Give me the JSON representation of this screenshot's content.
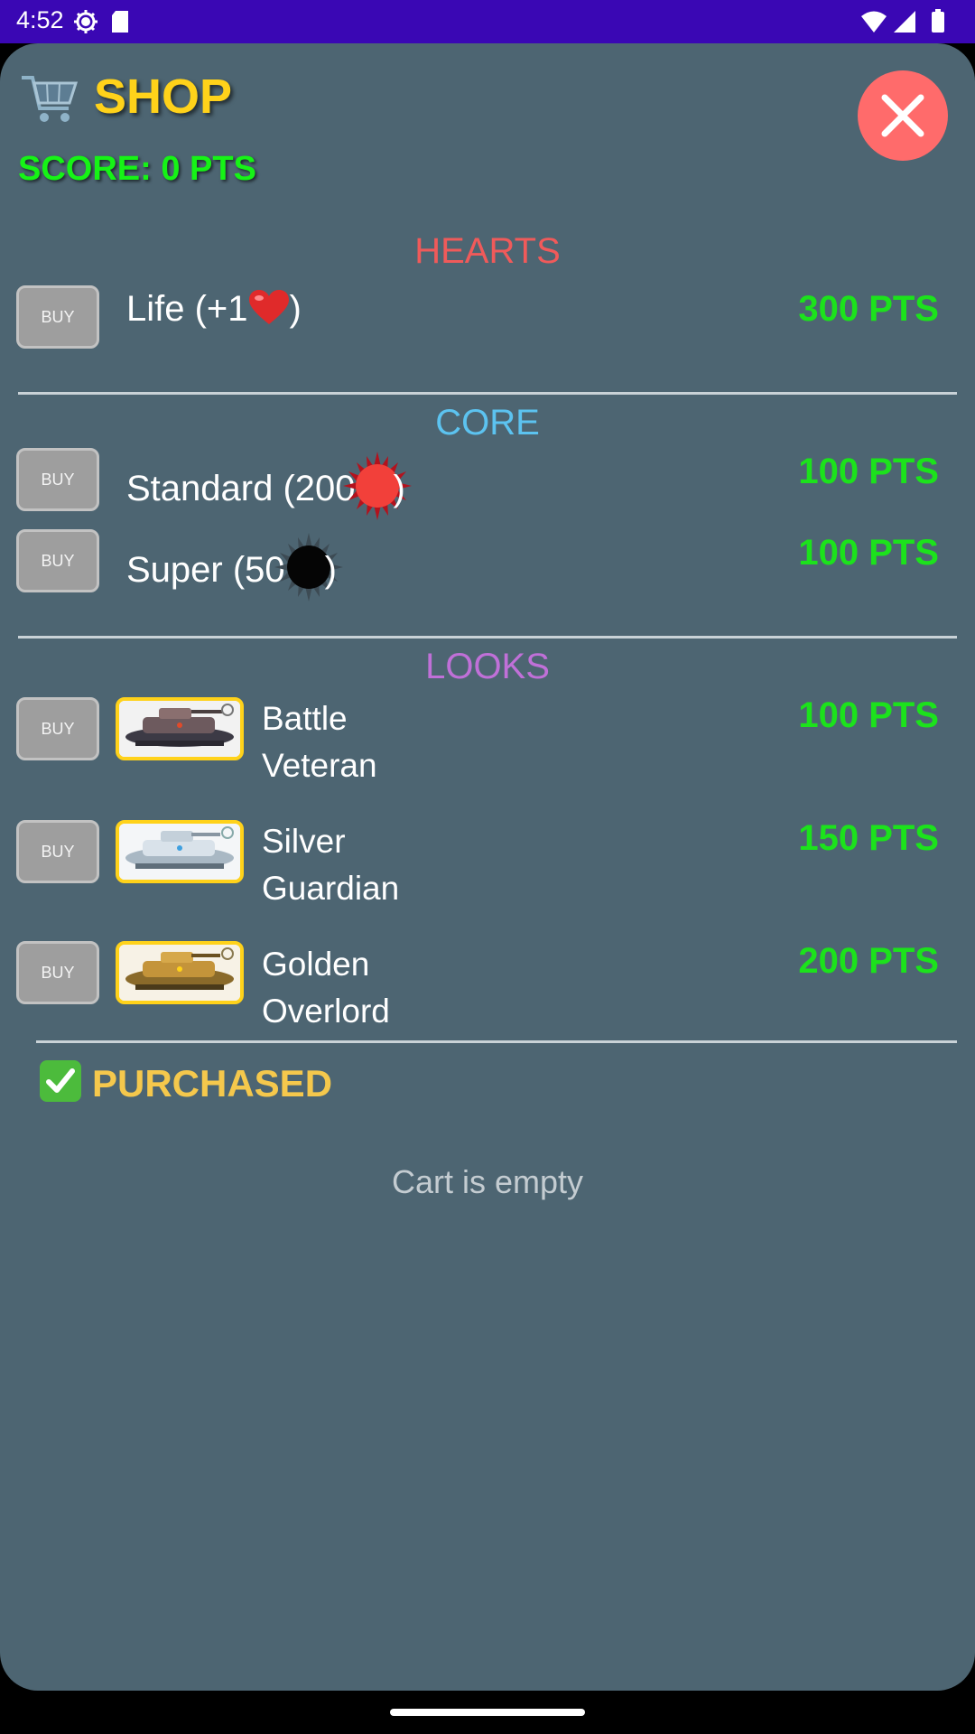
{
  "status_bar": {
    "time": "4:52"
  },
  "shop": {
    "title": "SHOP",
    "score": "SCORE: 0 PTS",
    "buy_label": "BUY",
    "sections": {
      "hearts": {
        "title": "HEARTS",
        "items": [
          {
            "label_text": "Life (+1",
            "label_suffix": ")",
            "icon": "heart-icon",
            "price": "300 PTS"
          }
        ]
      },
      "core": {
        "title": "CORE",
        "items": [
          {
            "label_text": "Standard (200",
            "label_suffix": ")",
            "icon": "red-core-icon",
            "price": "100 PTS"
          },
          {
            "label_text": "Super (50",
            "label_suffix": ")",
            "icon": "black-core-icon",
            "price": "100 PTS"
          }
        ]
      },
      "looks": {
        "title": "LOOKS",
        "items": [
          {
            "name_line1": "Battle",
            "name_line2": "Veteran",
            "price": "100 PTS",
            "thumb": "battle-veteran-ship"
          },
          {
            "name_line1": "Silver",
            "name_line2": "Guardian",
            "price": "150 PTS",
            "thumb": "silver-guardian-ship"
          },
          {
            "name_line1": "Golden",
            "name_line2": "Overlord",
            "price": "200 PTS",
            "thumb": "golden-overlord-ship"
          }
        ]
      }
    },
    "purchased": {
      "icon": "check-icon",
      "title": "PURCHASED",
      "empty_text": "Cart is empty"
    }
  },
  "colors": {
    "panel_bg": "#4d6572",
    "title": "#ffd21a",
    "score": "#16f316",
    "price": "#1ce21c",
    "hearts": "#f05a5a",
    "core": "#5cc3f0",
    "looks": "#c070d8",
    "purchased": "#f5c84c",
    "close": "#ff6b6b"
  }
}
